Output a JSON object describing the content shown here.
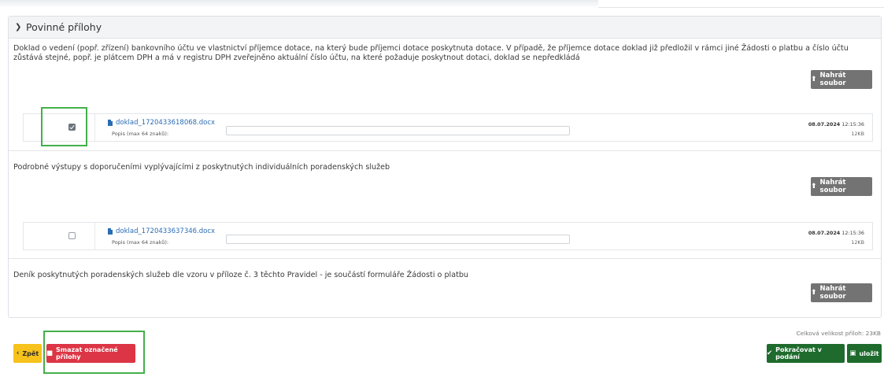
{
  "panel": {
    "title": "Povinné přílohy",
    "chevron_icon": "chevron-down-icon"
  },
  "sections": [
    {
      "text": "Doklad o vedení (popř. zřízení) bankovního účtu ve vlastnictví příjemce dotace, na který bude příjemci dotace poskytnuta dotace. V případě, že příjemce dotace doklad již předložil v rámci jiné Žádosti o platbu a číslo účtu zůstává stejné, popř. je plátcem DPH a má v registru DPH zveřejněno aktuální číslo účtu, na které požaduje poskytnout dotaci, doklad se nepředkládá",
      "upload_label": "Nahrát soubor",
      "file": {
        "checked": true,
        "name": "doklad_1720433618068.docx",
        "desc_label": "Popis (max 64 znaků):",
        "desc_value": "",
        "date": "08.07.2024",
        "time": "12:15:36",
        "size": "12KB"
      }
    },
    {
      "text": "Podrobné výstupy s doporučeními vyplývajícími z poskytnutých individuálních poradenských služeb",
      "upload_label": "Nahrát soubor",
      "file": {
        "checked": false,
        "name": "doklad_1720433637346.docx",
        "desc_label": "Popis (max 64 znaků):",
        "desc_value": "",
        "date": "08.07.2024",
        "time": "12:15:36",
        "size": "12KB"
      }
    },
    {
      "text": "Deník poskytnutých poradenských služeb dle vzoru v příloze č. 3 těchto Pravidel - je součástí formuláře Žádosti o platbu",
      "upload_label": "Nahrát soubor"
    }
  ],
  "total_size_label": "Celková velikost příloh: 23KB",
  "footer": {
    "back_label": "Zpět",
    "delete_label": "Smazat označené přílohy",
    "continue_label": "Pokračovat v podání",
    "save_label": "uložit"
  },
  "colors": {
    "upload_button": "#737373",
    "back_button": "#f6c21b",
    "delete_button": "#dc3545",
    "continue_button": "#1e6b2d",
    "highlight": "#43b04a",
    "file_link": "#2a6db5"
  },
  "icons": {
    "upload": "upload-icon",
    "file": "file-icon",
    "back": "chevron-left-icon",
    "delete": "trash-icon",
    "continue": "check-icon",
    "save": "save-icon"
  }
}
